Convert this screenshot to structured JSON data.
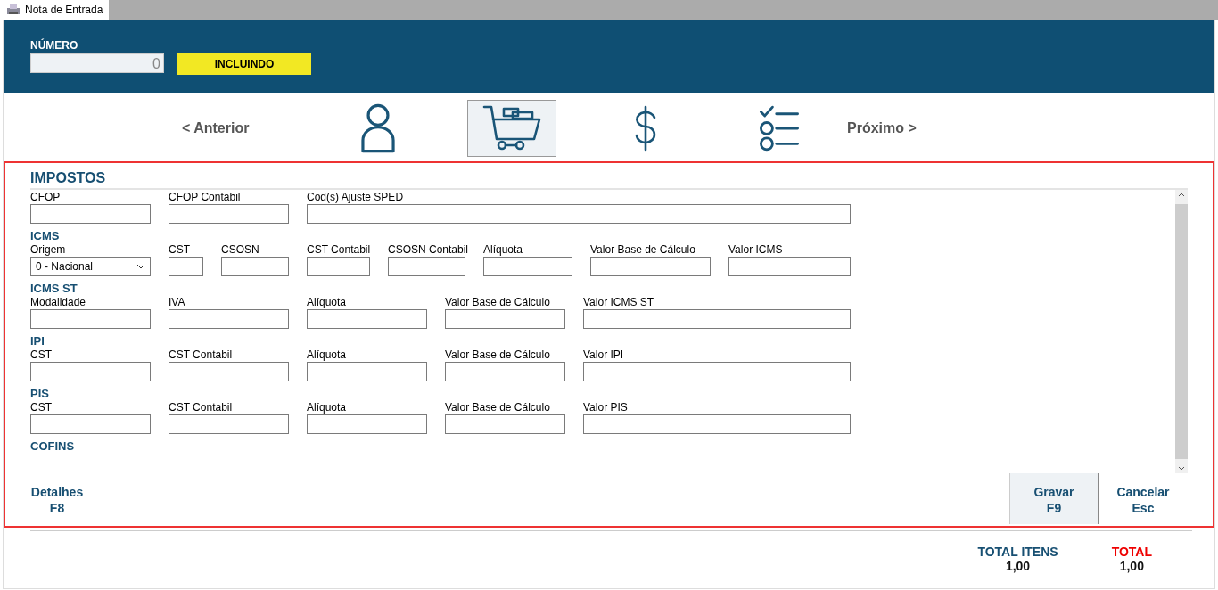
{
  "window": {
    "tab": "Nota de Entrada"
  },
  "header": {
    "number_label": "NÚMERO",
    "number_value": "0",
    "status": "INCLUINDO"
  },
  "nav": {
    "previous": "< Anterior",
    "next": "Próximo >",
    "steps": [
      {
        "kind": "person",
        "selected": false
      },
      {
        "kind": "cart",
        "selected": true
      },
      {
        "kind": "dollar",
        "selected": false
      },
      {
        "kind": "checklist",
        "selected": false
      }
    ]
  },
  "panel": {
    "title": "IMPOSTOS",
    "sections": [
      {
        "fields": [
          {
            "label": "CFOP",
            "kind": "input"
          },
          {
            "label": "CFOP Contabil",
            "kind": "input"
          },
          {
            "label": "Cod(s) Ajuste SPED",
            "kind": "input"
          }
        ]
      },
      {
        "title": "ICMS",
        "fields": [
          {
            "label": "Origem",
            "kind": "select",
            "value": "0 - Nacional"
          },
          {
            "label": "CST",
            "kind": "input"
          },
          {
            "label": "CSOSN",
            "kind": "input"
          },
          {
            "label": "CST Contabil",
            "kind": "input"
          },
          {
            "label": "CSOSN Contabil",
            "kind": "input"
          },
          {
            "label": "Alíquota",
            "kind": "input"
          },
          {
            "label": "Valor Base de Cálculo",
            "kind": "input"
          },
          {
            "label": "Valor ICMS",
            "kind": "input"
          }
        ]
      },
      {
        "title": "ICMS ST",
        "fields": [
          {
            "label": "Modalidade",
            "kind": "input"
          },
          {
            "label": "IVA",
            "kind": "input"
          },
          {
            "label": "Alíquota",
            "kind": "input"
          },
          {
            "label": "Valor Base de Cálculo",
            "kind": "input"
          },
          {
            "label": "Valor ICMS ST",
            "kind": "input"
          }
        ]
      },
      {
        "title": "IPI",
        "fields": [
          {
            "label": "CST",
            "kind": "input"
          },
          {
            "label": "CST Contabil",
            "kind": "input"
          },
          {
            "label": "Alíquota",
            "kind": "input"
          },
          {
            "label": "Valor Base de Cálculo",
            "kind": "input"
          },
          {
            "label": "Valor IPI",
            "kind": "input"
          }
        ]
      },
      {
        "title": "PIS",
        "fields": [
          {
            "label": "CST",
            "kind": "input"
          },
          {
            "label": "CST Contabil",
            "kind": "input"
          },
          {
            "label": "Alíquota",
            "kind": "input"
          },
          {
            "label": "Valor Base de Cálculo",
            "kind": "input"
          },
          {
            "label": "Valor PIS",
            "kind": "input"
          }
        ]
      },
      {
        "title": "COFINS"
      }
    ],
    "buttons": [
      {
        "label": "Detalhes",
        "key": "F8",
        "selected": false
      },
      {
        "label": "Gravar",
        "key": "F9",
        "selected": true
      },
      {
        "label": "Cancelar",
        "key": "Esc",
        "selected": false
      }
    ]
  },
  "totals": [
    {
      "label": "TOTAL ITENS",
      "value": "1,00",
      "kind": "normal"
    },
    {
      "label": "TOTAL",
      "value": "1,00",
      "kind": "highlight"
    }
  ]
}
